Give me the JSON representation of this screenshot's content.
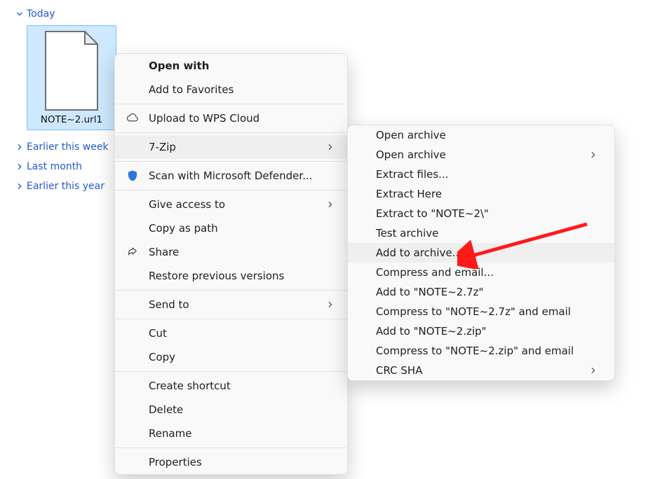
{
  "groups": {
    "today": "Today",
    "earlier_week": "Earlier this week",
    "last_month": "Last month",
    "earlier_year": "Earlier this year"
  },
  "file": {
    "name": "NOTE~2.url1"
  },
  "context_menu": {
    "open_with": "Open with",
    "add_to_favorites": "Add to Favorites",
    "upload_wps": "Upload to WPS Cloud",
    "seven_zip": "7-Zip",
    "scan_defender": "Scan with Microsoft Defender...",
    "give_access_to": "Give access to",
    "copy_as_path": "Copy as path",
    "share": "Share",
    "restore_versions": "Restore previous versions",
    "send_to": "Send to",
    "cut": "Cut",
    "copy": "Copy",
    "create_shortcut": "Create shortcut",
    "delete": "Delete",
    "rename": "Rename",
    "properties": "Properties"
  },
  "submenu": {
    "open_archive": "Open archive",
    "open_archive2": "Open archive",
    "extract_files": "Extract files...",
    "extract_here": "Extract Here",
    "extract_to_folder": "Extract to \"NOTE~2\\\"",
    "test_archive": "Test archive",
    "add_to_archive": "Add to archive...",
    "compress_email": "Compress and email...",
    "add_to_7z": "Add to \"NOTE~2.7z\"",
    "compress_7z_email": "Compress to \"NOTE~2.7z\" and email",
    "add_to_zip": "Add to \"NOTE~2.zip\"",
    "compress_zip_email": "Compress to \"NOTE~2.zip\" and email",
    "crc_sha": "CRC SHA"
  }
}
